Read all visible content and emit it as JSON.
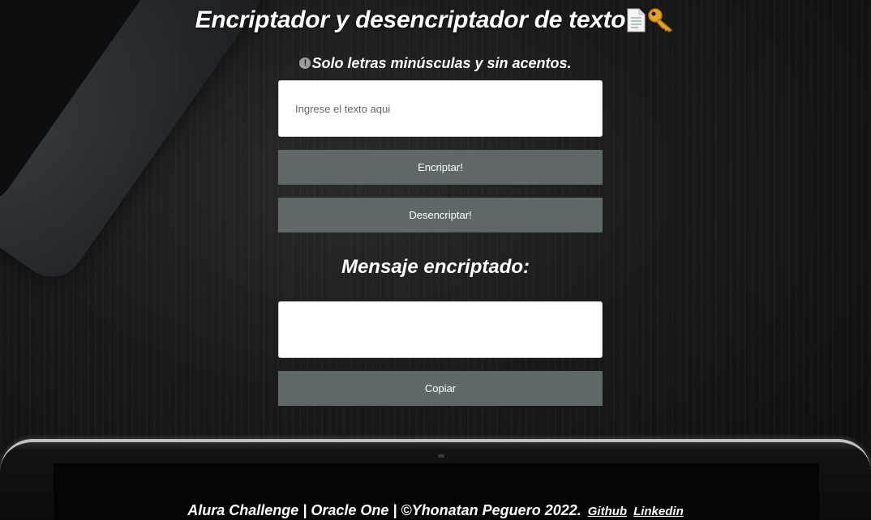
{
  "header": {
    "title": "Encriptador y desencriptador de texto",
    "icons": [
      "document-icon",
      "key-icon"
    ]
  },
  "notice": {
    "icon": "exclamation-icon",
    "text": "Solo letras minúsculas y sin acentos."
  },
  "input": {
    "placeholder": "Ingrese el texto aqui",
    "value": ""
  },
  "buttons": {
    "encrypt_label": "Encriptar!",
    "decrypt_label": "Desencriptar!",
    "copy_label": "Copiar"
  },
  "result": {
    "title": "Mensaje encriptado:",
    "value": ""
  },
  "footer": {
    "text": "Alura Challenge | Oracle One | ©Yhonatan Peguero 2022.",
    "github_label": "Github",
    "linkedin_label": "Linkedin"
  },
  "colors": {
    "button_bg": "#5e6868",
    "page_bg": "#141414",
    "text": "#ffffff"
  }
}
